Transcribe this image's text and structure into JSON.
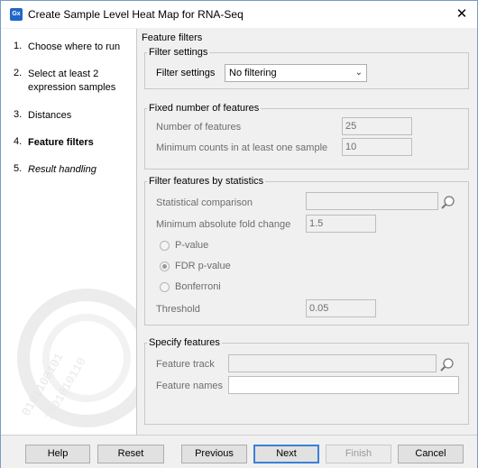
{
  "window": {
    "title": "Create Sample Level Heat Map for RNA-Seq",
    "app_icon": "Gx",
    "close_glyph": "✕"
  },
  "steps": [
    {
      "num": "1.",
      "label": "Choose where to run"
    },
    {
      "num": "2.",
      "label": "Select at least 2 expression samples"
    },
    {
      "num": "3.",
      "label": "Distances"
    },
    {
      "num": "4.",
      "label": "Feature filters"
    },
    {
      "num": "5.",
      "label": "Result handling"
    }
  ],
  "page_title": "Feature filters",
  "filter_settings": {
    "legend": "Filter settings",
    "label": "Filter settings",
    "value": "No filtering"
  },
  "fixed_number": {
    "legend": "Fixed number of features",
    "num_features_label": "Number of features",
    "num_features_value": "25",
    "min_counts_label": "Minimum counts in at least one sample",
    "min_counts_value": "10"
  },
  "statistics": {
    "legend": "Filter features by statistics",
    "comparison_label": "Statistical comparison",
    "comparison_value": "",
    "fold_change_label": "Minimum absolute fold change",
    "fold_change_value": "1.5",
    "radio_pvalue": "P-value",
    "radio_fdr": "FDR p-value",
    "radio_bonferroni": "Bonferroni",
    "threshold_label": "Threshold",
    "threshold_value": "0.05"
  },
  "specify": {
    "legend": "Specify features",
    "track_label": "Feature track",
    "track_value": "",
    "names_label": "Feature names",
    "names_value": ""
  },
  "buttons": {
    "help": "Help",
    "reset": "Reset",
    "previous": "Previous",
    "next": "Next",
    "finish": "Finish",
    "cancel": "Cancel"
  },
  "colors": {
    "accent": "#3c7fd6",
    "icon_blue": "#1e66c9"
  }
}
